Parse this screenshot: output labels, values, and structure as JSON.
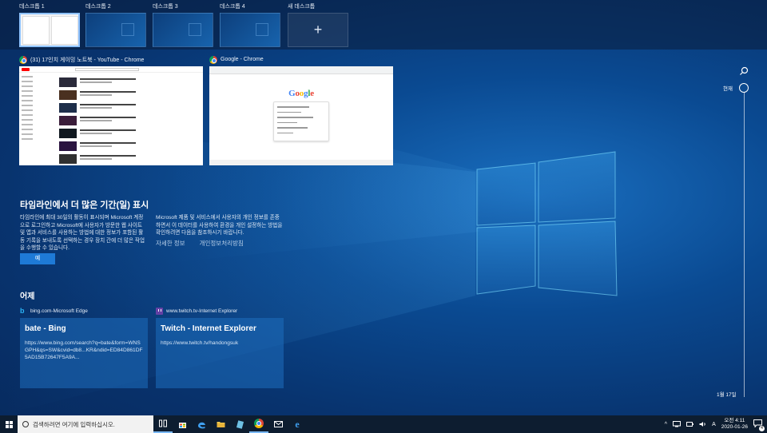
{
  "desktops": {
    "items": [
      {
        "label": "데스크톱 1",
        "active": true
      },
      {
        "label": "데스크톱 2",
        "active": false
      },
      {
        "label": "데스크톱 3",
        "active": false
      },
      {
        "label": "데스크톱 4",
        "active": false
      }
    ],
    "new_label": "새 데스크톱",
    "new_icon": "+"
  },
  "windows": [
    {
      "title": "(31) 17인치 게이밍 노트북 - YouTube - Chrome",
      "icon": "chrome-icon"
    },
    {
      "title": "Google - Chrome",
      "icon": "chrome-icon"
    }
  ],
  "google_logo": "Google",
  "promo": {
    "title": "타임라인에서 더 많은 기간(일) 표시",
    "text1": "타임라인에 최대 30일의 활동이 표시되며 Microsoft 계정으로 로그인하고 Microsoft에 사용자가 방문한 웹 사이트 및 앱과 서비스를 사용하는 방법에 대한 정보가 포함된 활동 기록을 보내도록 선택하는 경우 장치 간에 더 많은 작업을 수행할 수 있습니다.",
    "text2": "Microsoft 제품 및 서비스에서 사용자의 개인 정보를 존중하면서 이 데이터를 사용하여 환경을 개인 설정하는 방법을 확인하려면 다음을 참조하시기 바랍니다.",
    "link_details": "자세한 정보",
    "link_privacy": "개인정보처리방침",
    "yes_button": "예"
  },
  "yesterday": {
    "title": "어제",
    "activities": [
      {
        "source": "bing.com-Microsoft Edge",
        "icon": "bing-icon",
        "card_title": "bate - Bing",
        "url": "https://www.bing.com/search?q=bate&form=WNSGPH&qs=SW&cvid=db8...KR&ndid=ED84D861DF5AD15B72647F5A9A..."
      },
      {
        "source": "www.twitch.tv-Internet Explorer",
        "icon": "twitch-icon",
        "card_title": "Twitch - Internet Explorer",
        "url": "https://www.twitch.tv/handongsuk"
      }
    ]
  },
  "timeline": {
    "now_label": "현재",
    "date_label": "1월 17일"
  },
  "taskbar": {
    "search_placeholder": "검색하려면 여기에 입력하십시오.",
    "ime": "A",
    "time": "오전 4:11",
    "date": "2020-01-26",
    "notification_count": "4"
  },
  "colors": {
    "accent": "#1e7ad6",
    "taskbar": "#0d1d30",
    "card": "#1e6ebe"
  }
}
